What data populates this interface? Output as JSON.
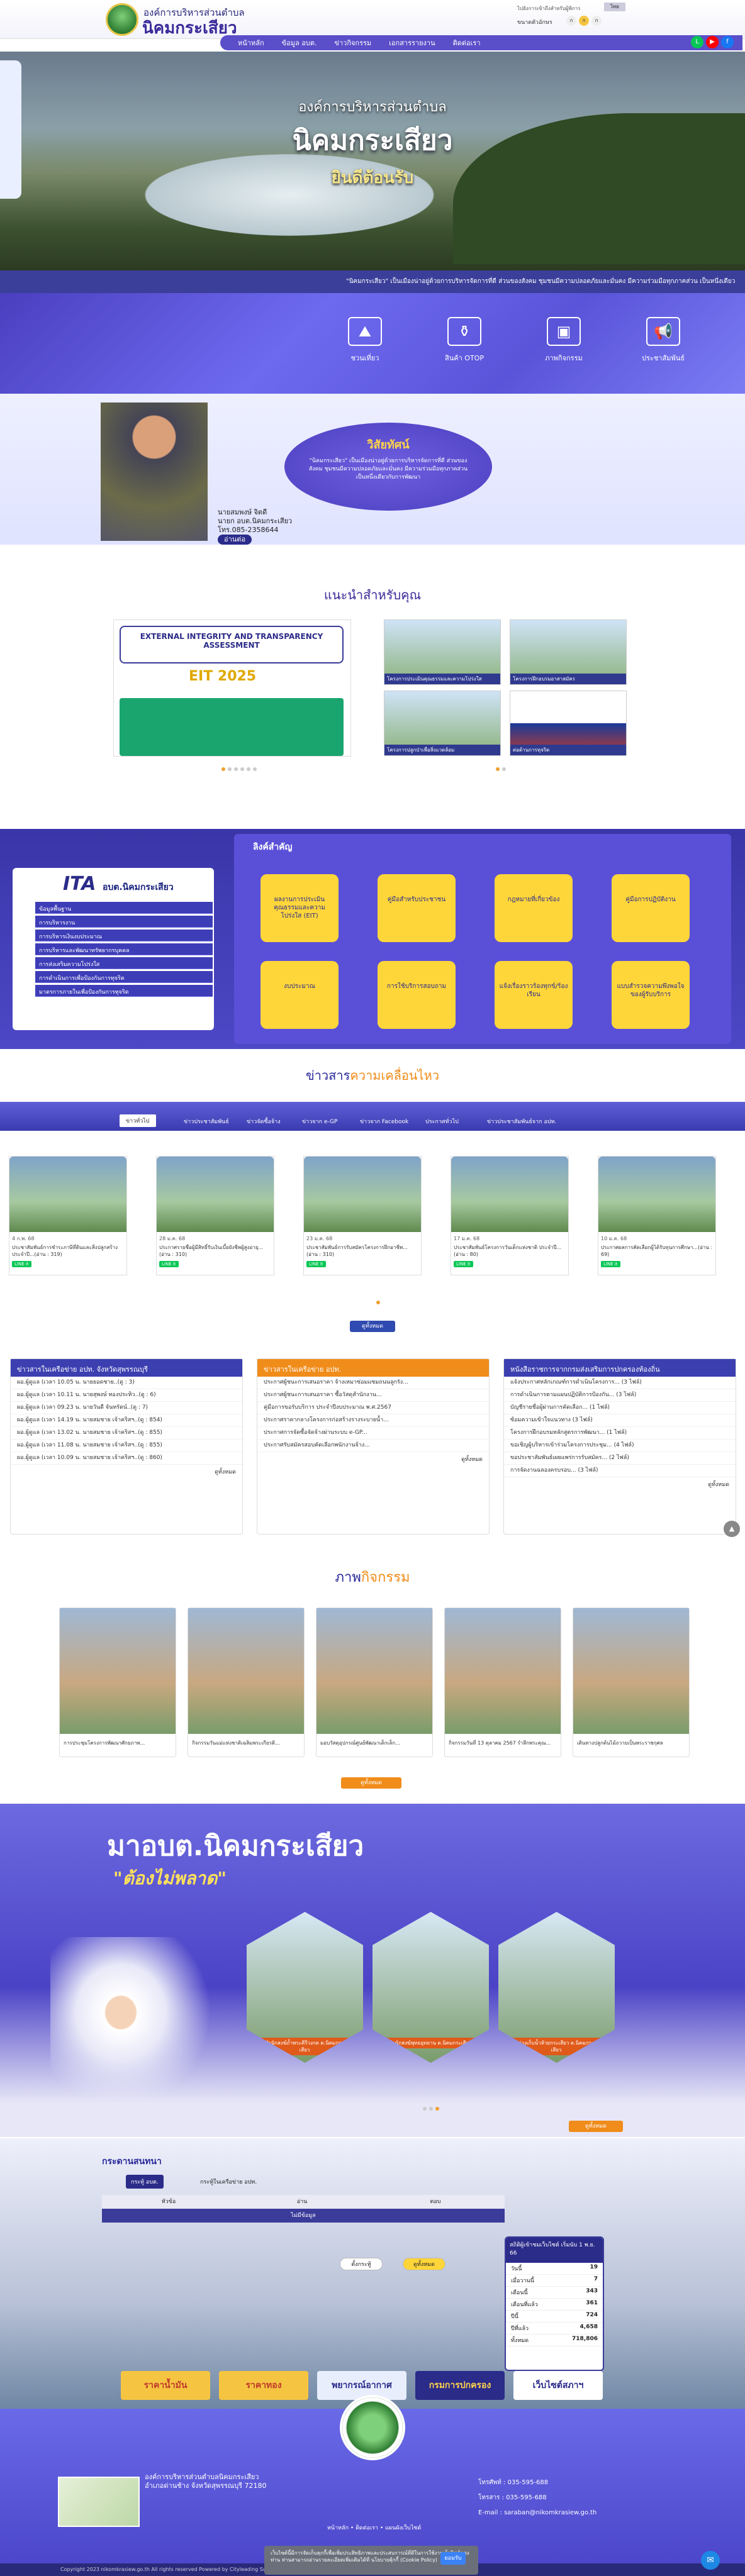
{
  "header": {
    "org_small": "องค์การบริหารส่วนตำบล",
    "org_big": "นิคมกระเสียว",
    "accessibility": "ไปยังการเข้าถึงสำหรับผู้พิการ",
    "acc_btn": "ไทย",
    "font_label": "ขนาดตัวอักษร",
    "font_sizes": [
      "ก",
      "ก",
      "ก"
    ]
  },
  "nav": {
    "items": [
      "หน้าหลัก",
      "ข้อมูล อบต.",
      "ข่าวกิจกรรม",
      "เอกสารรายงาน",
      "ติดต่อเรา"
    ]
  },
  "social": {
    "line": "#06c755",
    "youtube": "#ff0000",
    "facebook": "#1877f2"
  },
  "hero": {
    "line1": "องค์การบริหารส่วนตำบล",
    "line2": "นิคมกระเสียว",
    "line3": "ยินดีต้อนรับ",
    "ticker": "\"นิคมกระเสียว\" เป็นเมืองน่าอยู่ด้วยการบริหารจัดการที่ดี ส่วนของสังคม ชุมชนมีความปลอดภัยและมั่นคง มีความร่วมมือทุกภาคส่วน เป็นหนึ่งเดียว"
  },
  "quick": [
    {
      "label": "ชวนเที่ยว",
      "icon": "tour-icon"
    },
    {
      "label": "สินค้า OTOP",
      "icon": "otop-icon"
    },
    {
      "label": "ภาพกิจกรรม",
      "icon": "gallery-icon"
    },
    {
      "label": "ประชาสัมพันธ์",
      "icon": "megaphone-icon"
    }
  ],
  "mayor": {
    "name": "นายสมพงษ์ จิตดี",
    "position": "นายก อบต.นิคมกระเสียว",
    "phone": "โทร.085-2358644",
    "btn": "อ่านต่อ",
    "vision_title": "วิสัยทัศน์",
    "vision_text": "\"นิคมกระเสียว\" เป็นเมืองน่าอยู่ด้วยการบริหารจัดการที่ดี ส่วนของสังคม ชุมชนมีความปลอดภัยและมั่นคง มีความร่วมมือทุกภาคส่วน เป็นหนึ่งเดียวกับการพัฒนา"
  },
  "recommend": {
    "title": "แนะนำสำหรับคุณ",
    "ita_head": "EXTERNAL INTEGRITY AND TRANSPARENCY ASSESSMENT",
    "ita_year": "EIT 2025",
    "thumbs": [
      "โครงการประเมินคุณธรรมและความโปร่งใส",
      "โครงการฝึกอบรมอาสาสมัคร",
      "โครงการปลูกป่าเพื่อสิ่งแวดล้อม",
      "ต่อต้านการทุจริต"
    ]
  },
  "ita": {
    "logo": "ITA",
    "logo_sub": "อบต.นิคมกระเสียว",
    "items": [
      "ข้อมูลพื้นฐาน",
      "การบริหารงาน",
      "การบริหารเงินงบประมาณ",
      "การบริหารและพัฒนาทรัพยากรบุคคล",
      "การส่งเสริมความโปร่งใส",
      "การดำเนินการเพื่อป้องกันการทุจริต",
      "มาตรการภายในเพื่อป้องกันการทุจริต"
    ]
  },
  "important": {
    "title": "ลิงค์สำคัญ",
    "items": [
      "ผลงานการประเมินคุณธรรมและความโปร่งใส (EIT)",
      "คู่มือสำหรับประชาชน",
      "กฎหมายที่เกี่ยวข้อง",
      "คู่มือการปฏิบัติงาน",
      "งบประมาณ",
      "การใช้บริการสอบถาม",
      "แจ้งเรื่องราวร้องทุกข์/ร้องเรียน",
      "แบบสำรวจความพึงพอใจของผู้รับบริการ"
    ]
  },
  "news": {
    "title_a": "ข่าวสาร",
    "title_b": "ความเคลื่อนไหว",
    "tabs": [
      "ข่าวทั่วไป",
      "ข่าวประชาสัมพันธ์",
      "ข่าวจัดซื้อจ้าง",
      "ข่าวจาก e-GP",
      "ข่าวจาก Facebook",
      "ประกาศทั่วไป",
      "ข่าวประชาสัมพันธ์จาก อปท."
    ],
    "cards": [
      {
        "date": "4 ก.พ. 68",
        "text": "ประชาสัมพันธ์การชำระภาษีที่ดินและสิ่งปลูกสร้าง ประจำปี...(อ่าน : 319)"
      },
      {
        "date": "28 ม.ค. 68",
        "text": "ประกาศรายชื่อผู้มีสิทธิ์รับเงินเบี้ยยังชีพผู้สูงอายุ...(อ่าน : 310)"
      },
      {
        "date": "23 ม.ค. 68",
        "text": "ประชาสัมพันธ์การรับสมัครโครงการฝึกอาชีพ...(อ่าน : 310)"
      },
      {
        "date": "17 ม.ค. 68",
        "text": "ประชาสัมพันธ์โครงการวันเด็กแห่งชาติ ประจำปี...(อ่าน : 80)"
      },
      {
        "date": "10 ม.ค. 68",
        "text": "ประกาศผลการคัดเลือกผู้ได้รับทุนการศึกษา...(อ่าน : 69)"
      }
    ],
    "badge": "LINE it",
    "more": "ดูทั้งหมด"
  },
  "boards": [
    {
      "title": "ข่าวสารในเครือข่าย อปท. จังหวัดสุพรรณบุรี",
      "color": "#3b3fb0",
      "rows": [
        "ผอ.ผู้ดูแล  (เวลา 10.05 น. นายยอดชาย..(ดู : 3)",
        "ผอ.ผู้ดูแล  (เวลา 10.11 น. นายสุพงษ์ ทองประทิว..(ดู : 6)",
        "ผอ.ผู้ดูแล  (เวลา 09.23 น. นายวันดี จันทรัตน์..(ดู : 7)",
        "ผอ.ผู้ดูแล  (เวลา 14.19 น. นายสมชาย เจ้าคริสฯ..(ดู : 854)",
        "ผอ.ผู้ดูแล  (เวลา 13.02 น. นายสมชาย เจ้าคริสฯ..(ดู : 855)",
        "ผอ.ผู้ดูแล  (เวลา 11.08 น. นายสมชาย เจ้าคริสฯ..(ดู : 855)",
        "ผอ.ผู้ดูแล  (เวลา 10.09 น. นายสมชาย เจ้าคริสฯ..(ดู : 860)"
      ],
      "more": "ดูทั้งหมด"
    },
    {
      "title": "ข่าวสารในเครือข่าย อปท.",
      "color": "#f08c1a",
      "rows": [
        "ประกาศผู้ชนะการเสนอราคา จ้างเหมาซ่อมแซมถนนลูกรัง...",
        "ประกาศผู้ชนะการเสนอราคา ซื้อวัสดุสำนักงาน...",
        "คู่มือการขอรับบริการ ประจำปีงบประมาณ พ.ศ.2567",
        "ประกาศราคากลางโครงการก่อสร้างรางระบายน้ำ...",
        "ประกาศการจัดซื้อจัดจ้างผ่านระบบ e-GP...",
        "ประกาศรับสมัครสอบคัดเลือกพนักงานจ้าง..."
      ],
      "more": "ดูทั้งหมด"
    },
    {
      "title": "หนังสือราชการจากกรมส่งเสริมการปกครองท้องถิ่น",
      "color": "#3b3fb0",
      "rows": [
        "แจ้งประกาศหลักเกณฑ์การดำเนินโครงการ... (3 ไฟล์)",
        "การดำเนินการตามแผนปฏิบัติการป้องกัน... (3 ไฟล์)",
        "บัญชีรายชื่อผู้ผ่านการคัดเลือก... (1 ไฟล์)",
        "ซ้อมความเข้าใจแนวทาง (3 ไฟล์)",
        "โครงการฝึกอบรมหลักสูตรการพัฒนา... (1 ไฟล์)",
        "ขอเชิญผู้บริหารเข้าร่วมโครงการประชุม... (4 ไฟล์)",
        "ขอประชาสัมพันธ์เผยแพร่การรับสมัคร... (2 ไฟล์)",
        "การจัดงานฉลองครบรอบ... (3 ไฟล์)"
      ],
      "more": "ดูทั้งหมด"
    }
  ],
  "activity": {
    "title_a": "ภาพ",
    "title_b": "กิจกรรม",
    "cards": [
      "การประชุมโครงการพัฒนาศักยภาพ...",
      "กิจกรรมวันแม่แห่งชาติเฉลิมพระเกียรติ...",
      "มอบวัสดุอุปกรณ์ศูนย์พัฒนาเด็กเล็ก...",
      "กิจกรรมวันที่ 13 ตุลาคม 2567 รำลึกพระคุณ...",
      "เดินทางปลูกต้นไม้ถวายเป็นพระราชกุศล"
    ],
    "more": "ดูทั้งหมด"
  },
  "tour": {
    "line1": "มาอบต.นิคมกระเสียว",
    "line2": "\"ต้องไม่พลาด\"",
    "places": [
      "สำนักสงฆ์ถ้ำพระคีรีวงกต ต.นิคมกระเสียว",
      "สำนักสงฆ์พุทธอุทยาน ต.นิคมกระเสียว",
      "อ่างเก็บน้ำห้วยกระเสียว ต.นิคมกระเสียว"
    ],
    "more": "ดูทั้งหมด"
  },
  "poll": {
    "title": "กระดานสนทนา",
    "tabs": [
      "กระทู้ อบต.",
      "กระทู้ในเครือข่าย อปท."
    ],
    "cols": [
      "หัวข้อ",
      "อ่าน",
      "ตอบ"
    ],
    "empty": "ไม่มีข้อมูล",
    "btn1": "ตั้งกระทู้",
    "btn2": "ดูทั้งหมด"
  },
  "stats": {
    "head": "สถิติผู้เข้าชมเว็บไซต์ เริ่มนับ 1 พ.ย. 66",
    "rows": [
      [
        "วันนี้",
        "19"
      ],
      [
        "เมื่อวานนี้",
        "7"
      ],
      [
        "เดือนนี้",
        "343"
      ],
      [
        "เดือนที่แล้ว",
        "361"
      ],
      [
        "ปีนี้",
        "724"
      ],
      [
        "ปีที่แล้ว",
        "4,658"
      ],
      [
        "ทั้งหมด",
        "718,806"
      ]
    ]
  },
  "banners": [
    "ราคาน้ำมัน",
    "ราคาทอง",
    "พยากรณ์อากาศ",
    "กรมการปกครอง",
    "เว็บไซต์สภาฯ"
  ],
  "footer": {
    "name": "องค์การบริหารส่วนตำบลนิคมกระเสียว",
    "addr": "อำเภอด่านช้าง จังหวัดสุพรรณบุรี 72180",
    "phone": "โทรศัพท์ : 035-595-688",
    "fax": "โทรสาร : 035-595-688",
    "email": "E-mail : saraban@nikomkrasiew.go.th",
    "links": "หน้าหลัก  •  ติดต่อเรา  •  แผนผังเว็บไซต์",
    "copyright": "Copyright 2023 nikomkrasiew.go.th All rights reserved Powered by Cityleading Supply",
    "cookie": "เว็บไซต์นี้มีการจัดเก็บคุกกี้เพื่อเพิ่มประสิทธิภาพและประสบการณ์ที่ดีในการใช้งานเว็บไซต์ของท่าน ท่านสามารถอ่านรายละเอียดเพิ่มเติมได้ที่ นโยบายคุ้กกี้ (Cookie Policy)",
    "cookie_btn": "ยอมรับ"
  }
}
